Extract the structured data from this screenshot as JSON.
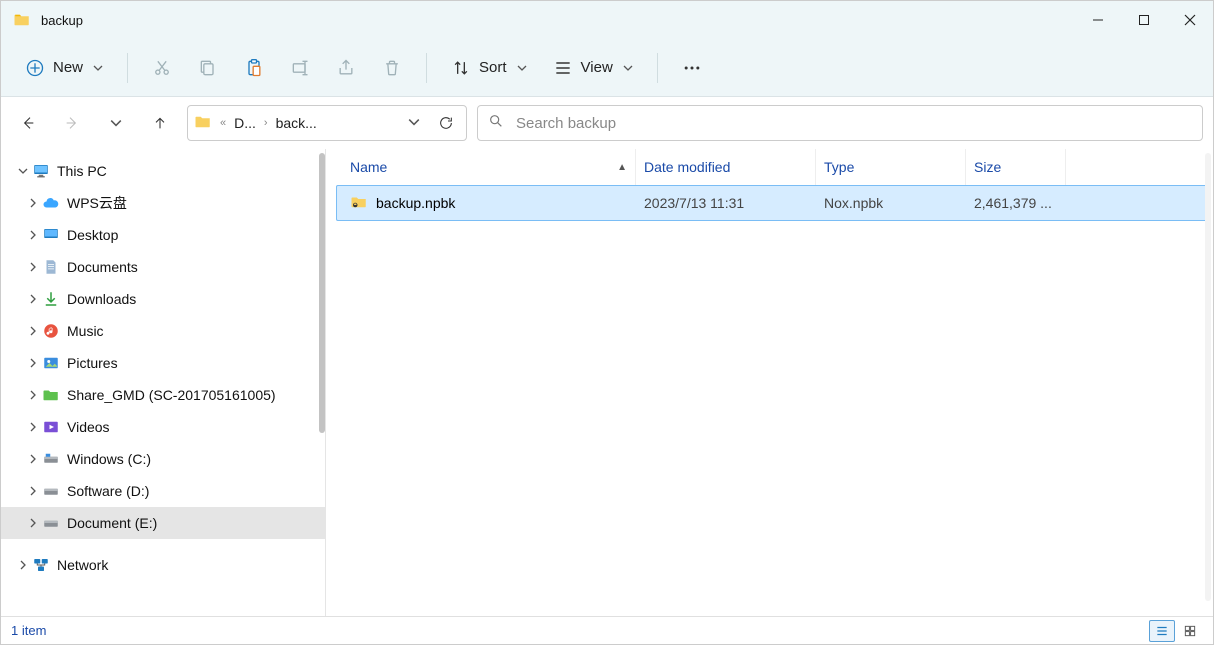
{
  "window": {
    "title": "backup"
  },
  "toolbar": {
    "new_label": "New",
    "sort_label": "Sort",
    "view_label": "View"
  },
  "address": {
    "segment1": "D...",
    "segment2": "back..."
  },
  "search": {
    "placeholder": "Search backup"
  },
  "sidebar": {
    "this_pc": "This PC",
    "items": [
      {
        "label": "WPS云盘"
      },
      {
        "label": "Desktop"
      },
      {
        "label": "Documents"
      },
      {
        "label": "Downloads"
      },
      {
        "label": "Music"
      },
      {
        "label": "Pictures"
      },
      {
        "label": "Share_GMD (SC-201705161005)"
      },
      {
        "label": "Videos"
      },
      {
        "label": "Windows (C:)"
      },
      {
        "label": "Software (D:)"
      },
      {
        "label": "Document (E:)"
      }
    ],
    "network": "Network"
  },
  "columns": {
    "name": "Name",
    "date": "Date modified",
    "type": "Type",
    "size": "Size"
  },
  "files": [
    {
      "name": "backup.npbk",
      "date": "2023/7/13 11:31",
      "type": "Nox.npbk",
      "size": "2,461,379 ..."
    }
  ],
  "status": {
    "count": "1 item"
  }
}
